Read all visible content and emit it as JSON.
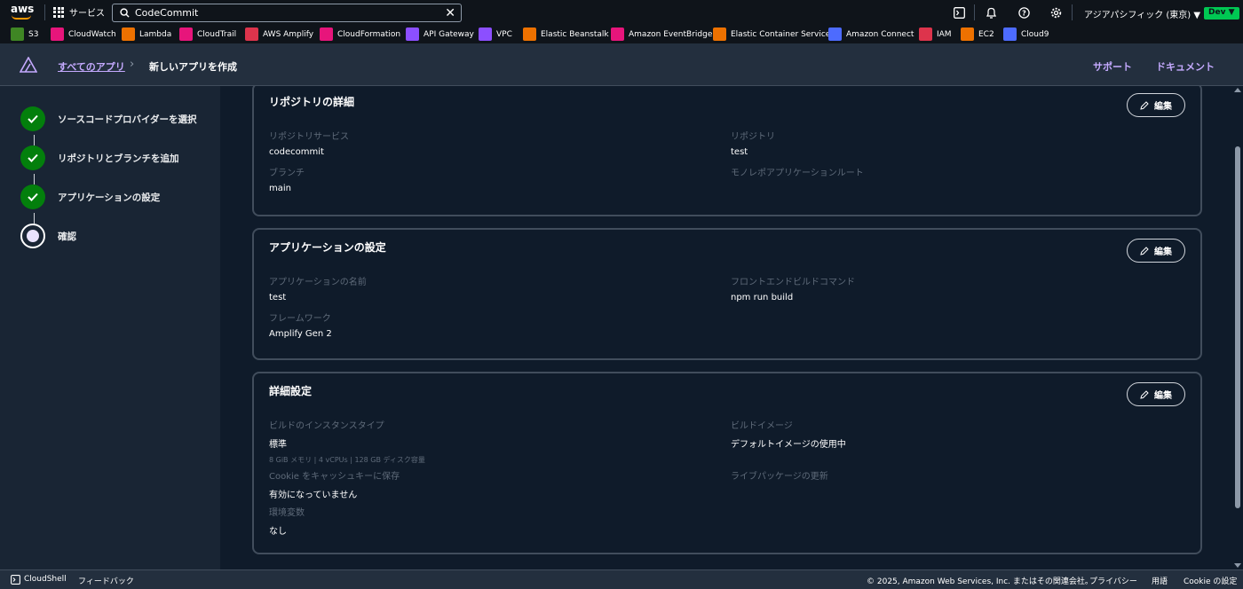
{
  "topbar": {
    "services_label": "サービス",
    "search_value": "CodeCommit",
    "region": "アジアパシフィック (東京) ▼",
    "account": "Dev ▼"
  },
  "favorites": [
    {
      "label": "S3",
      "color": "#3f8624",
      "icon": "bucket-icon"
    },
    {
      "label": "CloudWatch",
      "color": "#e7157b",
      "icon": "cloudwatch-icon"
    },
    {
      "label": "Lambda",
      "color": "#ed7100",
      "icon": "lambda-icon"
    },
    {
      "label": "CloudTrail",
      "color": "#e7157b",
      "icon": "cloudtrail-icon"
    },
    {
      "label": "AWS Amplify",
      "color": "#dd344c",
      "icon": "amplify-icon"
    },
    {
      "label": "CloudFormation",
      "color": "#e7157b",
      "icon": "cloudformation-icon"
    },
    {
      "label": "API Gateway",
      "color": "#8c4fff",
      "icon": "api-gateway-icon"
    },
    {
      "label": "VPC",
      "color": "#8c4fff",
      "icon": "vpc-icon"
    },
    {
      "label": "Elastic Beanstalk",
      "color": "#ed7100",
      "icon": "beanstalk-icon"
    },
    {
      "label": "Amazon EventBridge",
      "color": "#e7157b",
      "icon": "eventbridge-icon"
    },
    {
      "label": "Elastic Container Service",
      "color": "#ed7100",
      "icon": "ecs-icon"
    },
    {
      "label": "Amazon Connect",
      "color": "#4d6bfe",
      "icon": "connect-icon"
    },
    {
      "label": "IAM",
      "color": "#dd344c",
      "icon": "iam-icon"
    },
    {
      "label": "EC2",
      "color": "#ed7100",
      "icon": "ec2-icon"
    },
    {
      "label": "Cloud9",
      "color": "#4d6bfe",
      "icon": "cloud9-icon"
    }
  ],
  "appbar": {
    "breadcrumb_link": "すべてのアプリ",
    "breadcrumb_current": "新しいアプリを作成",
    "support": "サポート",
    "docs": "ドキュメント"
  },
  "steps": [
    {
      "label": "ソースコードプロバイダーを選択",
      "state": "done"
    },
    {
      "label": "リポジトリとブランチを追加",
      "state": "done"
    },
    {
      "label": "アプリケーションの設定",
      "state": "done"
    },
    {
      "label": "確認",
      "state": "current"
    }
  ],
  "edit_label": "編集",
  "repo_card": {
    "title": "リポジトリの詳細",
    "service_key": "リポジトリサービス",
    "service_val": "codecommit",
    "repo_key": "リポジトリ",
    "repo_val": "test",
    "branch_key": "ブランチ",
    "branch_val": "main",
    "monorepo_key": "モノレポアプリケーションルート"
  },
  "app_card": {
    "title": "アプリケーションの設定",
    "name_key": "アプリケーションの名前",
    "name_val": "test",
    "build_key": "フロントエンドビルドコマンド",
    "build_val": "npm run build",
    "framework_key": "フレームワーク",
    "framework_val": "Amplify Gen 2"
  },
  "adv_card": {
    "title": "詳細設定",
    "instance_key": "ビルドのインスタンスタイプ",
    "instance_val": "標準",
    "instance_sub": "8 GiB メモリ | 4 vCPUs | 128 GB ディスク容量",
    "image_key": "ビルドイメージ",
    "image_val": "デフォルトイメージの使用中",
    "cookie_key": "Cookie をキャッシュキーに保存",
    "cookie_val": "有効になっていません",
    "livepkg_key": "ライブパッケージの更新",
    "env_key": "環境変数",
    "env_val": "なし"
  },
  "footer": {
    "cloudshell": "CloudShell",
    "feedback": "フィードバック",
    "copyright": "© 2025, Amazon Web Services, Inc. またはその関連会社。",
    "privacy": "プライバシー",
    "terms": "用語",
    "cookie": "Cookie の設定"
  }
}
